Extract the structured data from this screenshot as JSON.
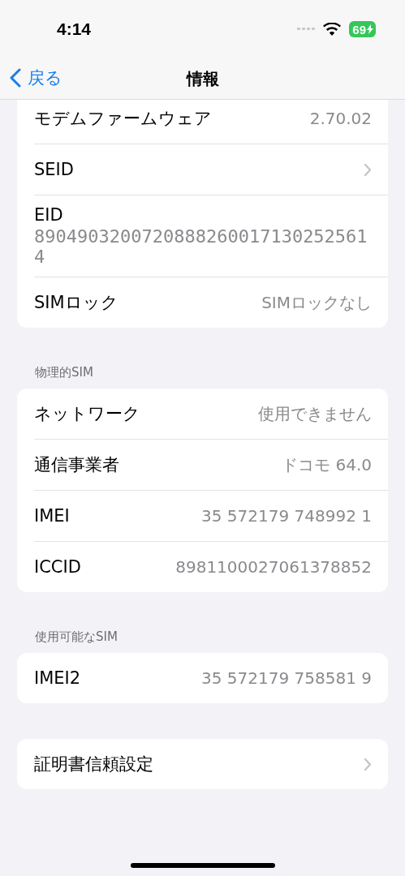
{
  "status_bar": {
    "time": "4:14",
    "battery": "69"
  },
  "nav": {
    "back": "戻る",
    "title": "情報"
  },
  "sections": [
    {
      "rows": [
        {
          "kind": "value",
          "label": "モデムファームウェア",
          "value": "2.70.02"
        },
        {
          "kind": "link",
          "label": "SEID"
        },
        {
          "kind": "stacked",
          "label": "EID",
          "value": "89049032007208882600171302525614"
        },
        {
          "kind": "value",
          "label": "SIMロック",
          "value": "SIMロックなし"
        }
      ]
    },
    {
      "header": "物理的SIM",
      "rows": [
        {
          "kind": "value",
          "label": "ネットワーク",
          "value": "使用できません"
        },
        {
          "kind": "value",
          "label": "通信事業者",
          "value": "ドコモ 64.0"
        },
        {
          "kind": "value",
          "label": "IMEI",
          "value": "35 572179 748992 1"
        },
        {
          "kind": "value",
          "label": "ICCID",
          "value": "8981100027061378852"
        }
      ]
    },
    {
      "header": "使用可能なSIM",
      "rows": [
        {
          "kind": "value",
          "label": "IMEI2",
          "value": "35 572179 758581 9"
        }
      ]
    },
    {
      "rows": [
        {
          "kind": "link",
          "label": "証明書信頼設定"
        }
      ]
    }
  ]
}
